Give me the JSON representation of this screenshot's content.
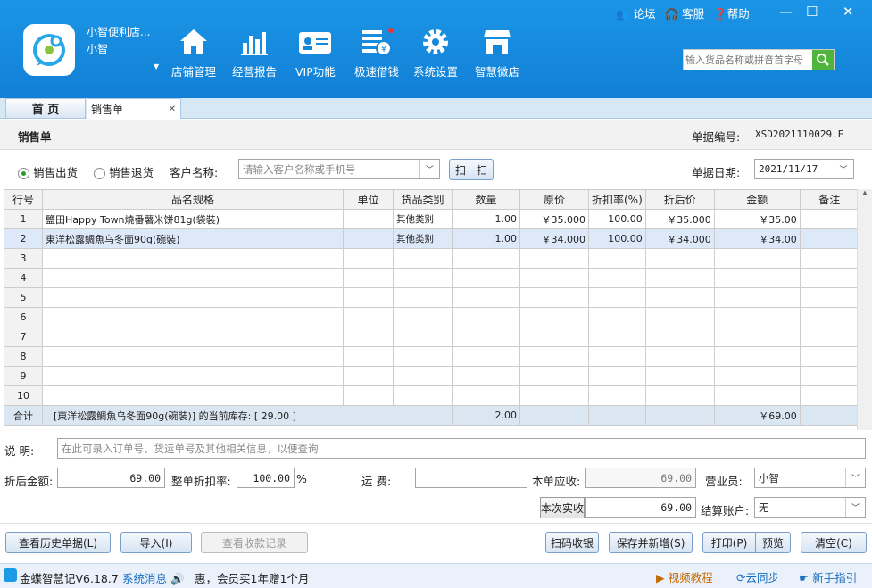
{
  "store": {
    "name": "小智便利店...",
    "user": "小智"
  },
  "nav": [
    {
      "label": "店铺管理",
      "icon": "home-icon"
    },
    {
      "label": "经营报告",
      "icon": "bar-chart-icon"
    },
    {
      "label": "VIP功能",
      "icon": "vip-card-icon"
    },
    {
      "label": "极速借钱",
      "icon": "loan-icon"
    },
    {
      "label": "系统设置",
      "icon": "gear-icon"
    },
    {
      "label": "智慧微店",
      "icon": "shop-icon"
    }
  ],
  "toplinks": {
    "forum": "论坛",
    "service": "客服",
    "help": "帮助"
  },
  "search": {
    "placeholder": "输入货品名称或拼音首字母"
  },
  "tabs": {
    "home": "首  页",
    "sales": "销售单"
  },
  "form": {
    "title": "销售单",
    "doc_no_label": "单据编号:",
    "doc_no": "XSD2021110029.E",
    "radio_out": "销售出货",
    "radio_return": "销售退货",
    "customer_label": "客户名称:",
    "customer_placeholder": "请输入客户名称或手机号",
    "scan": "扫一扫",
    "date_label": "单据日期:",
    "date": "2021/11/17"
  },
  "table": {
    "headers": [
      "行号",
      "品名规格",
      "单位",
      "货品类别",
      "数量",
      "原价",
      "折扣率(%)",
      "折后价",
      "金额",
      "备注"
    ],
    "rows": [
      {
        "no": "1",
        "name": "鹽田Happy Town燒番薯米饼81g(袋裝)",
        "unit": "",
        "cat": "其他类别",
        "qty": "1.00",
        "price": "￥35.000",
        "disc": "100.00",
        "after": "￥35.000",
        "amt": "￥35.00",
        "note": ""
      },
      {
        "no": "2",
        "name": "東洋松露鲷魚乌冬面90g(碗裝)",
        "unit": "",
        "cat": "其他类别",
        "qty": "1.00",
        "price": "￥34.000",
        "disc": "100.00",
        "after": "￥34.000",
        "amt": "￥34.00",
        "note": ""
      },
      {
        "no": "3"
      },
      {
        "no": "4"
      },
      {
        "no": "5"
      },
      {
        "no": "6"
      },
      {
        "no": "7"
      },
      {
        "no": "8"
      },
      {
        "no": "9"
      },
      {
        "no": "10"
      }
    ],
    "sum_label": "合计",
    "stock_text": "[東洋松露鲷魚乌冬面90g(碗裝)] 的当前库存: [ 29.00 ]",
    "sum_qty": "2.00",
    "sum_amt": "￥69.00"
  },
  "bottom": {
    "desc_label": "说  明:",
    "desc_placeholder": "在此可录入订单号、货运单号及其他相关信息，以便查询",
    "after_amt_label": "折后金额:",
    "after_amt": "69.00",
    "whole_disc_label": "整单折扣率:",
    "whole_disc": "100.00",
    "pct": "%",
    "freight_label": "运    费:",
    "receivable_label": "本单应收:",
    "receivable": "69.00",
    "salesman_label": "营业员:",
    "salesman": "小智",
    "paid_btn": "本次实收",
    "paid": "69.00",
    "account_label": "结算账户:",
    "account": "无"
  },
  "actions": {
    "history": "查看历史单据(L)",
    "import": "导入(I)",
    "receipts": "查看收款记录",
    "scan_pay": "扫码收银",
    "save_new": "保存并新增(S)",
    "print": "打印(P)",
    "preview": "预览",
    "clear": "清空(C)"
  },
  "footer": {
    "app": "金蝶智慧记V6.18.7",
    "sysmsg": "系统消息",
    "marquee": "惠，会员买1年赠1个月",
    "video": "视频教程",
    "sync": "云同步",
    "guide": "新手指引"
  }
}
